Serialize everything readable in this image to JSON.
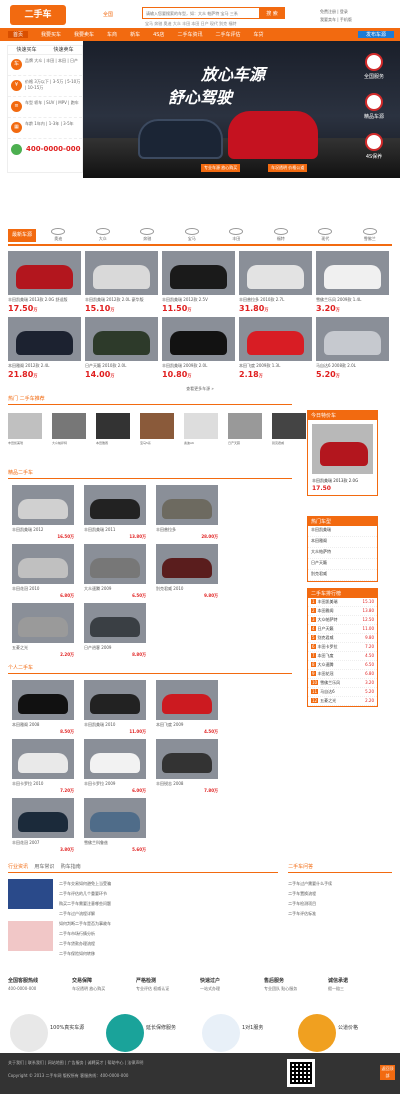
{
  "header": {
    "logo_text": "二手车",
    "city": "全国",
    "search_placeholder": "请输入您要搜索的车型，如：大众 帕萨特 宝马 三系",
    "search_button": "搜 索",
    "hot_keywords": "宝马 奔驰 奥迪 大众 丰田 本田 日产 现代 别克 福特",
    "top_links": [
      "免费注册",
      "登录",
      "我要卖车",
      "手机版"
    ]
  },
  "nav": {
    "items": [
      "首页",
      "我要买车",
      "我要卖车",
      "车商",
      "新车",
      "4S店",
      "二手车资讯",
      "二手车评估",
      "车贷"
    ],
    "right_button": "发布车源"
  },
  "left_panel": {
    "tabs": [
      "快速买车",
      "快速卖车"
    ],
    "rows": [
      {
        "icon": "car-icon",
        "text": "品牌 大众 | 丰田 | 本田 | 日产"
      },
      {
        "icon": "yuan-icon",
        "text": "价格 3万以下 | 3-5万 | 5-10万 | 10-15万"
      },
      {
        "icon": "list-icon",
        "text": "车型 轿车 | SUV | MPV | 跑车"
      },
      {
        "icon": "calendar-icon",
        "text": "车龄 1年内 | 1-3年 | 3-5年"
      }
    ],
    "phone": "400-0000-000"
  },
  "hero": {
    "slogan1": "放心车源",
    "slogan2": "舒心驾驶",
    "tag1": "专业车源 放心购买",
    "tag2": "车况透明 价格公道",
    "side": [
      "全国服务",
      "精品车源",
      "4S保养"
    ]
  },
  "brands": {
    "header": "最新车源",
    "items": [
      "奥迪",
      "大众",
      "奔驰",
      "宝马",
      "丰田",
      "福特",
      "现代",
      "雪佛兰"
    ]
  },
  "cars": [
    {
      "title": "丰田凯美瑞 2013款 2.0G 舒适版",
      "price": "17.50",
      "color": "#b3161e"
    },
    {
      "title": "丰田凯美瑞 2012款 2.0L 豪华版",
      "price": "15.10",
      "color": "#d9d9d9"
    },
    {
      "title": "丰田凯美瑞 2012款 2.5V",
      "price": "11.50",
      "color": "#1a1a1a"
    },
    {
      "title": "丰田普拉多 2010款 2.7L",
      "price": "31.80",
      "color": "#e3e3e3"
    },
    {
      "title": "雪佛兰乐风 2009款 1.4L",
      "price": "3.20",
      "color": "#f0f0f0"
    },
    {
      "title": "本田雅阁 2012款 2.4L",
      "price": "21.80",
      "color": "#1c2230"
    },
    {
      "title": "日产天籁 2010款 2.0L",
      "price": "14.00",
      "color": "#2d3a2a"
    },
    {
      "title": "丰田凯美瑞 2009款 2.0L",
      "price": "10.80",
      "color": "#121212"
    },
    {
      "title": "本田飞度 2009款 1.3L",
      "price": "2.18",
      "color": "#d81d24"
    },
    {
      "title": "马自达6 2008款 2.0L",
      "price": "5.20",
      "color": "#c6c9cf"
    }
  ],
  "price_unit": "万",
  "more_label": "查看更多车源 »",
  "recommend": {
    "header": "热门 二手车推荐",
    "thumbs": [
      "丰田凯美瑞",
      "大众帕萨特",
      "本田雅阁",
      "宝马5系",
      "奥迪A6",
      "日产天籁",
      "别克君威"
    ]
  },
  "featured": {
    "header": "今日特价车",
    "title": "丰田凯美瑞 2013款 2.0G",
    "price": "17.50"
  },
  "section_a": {
    "header": "精品二手车",
    "cars": [
      {
        "title": "丰田凯美瑞 2012",
        "price": "16.50万",
        "color": "#d0d0d0"
      },
      {
        "title": "丰田凯美瑞 2011",
        "price": "13.80万",
        "color": "#222"
      },
      {
        "title": "丰田普拉多",
        "price": "28.00万",
        "color": "#6d6a60"
      },
      {
        "title": "丰田花冠 2010",
        "price": "6.80万",
        "color": "#c0c0c0"
      },
      {
        "title": "大众速腾 2009",
        "price": "6.50万",
        "color": "#777"
      },
      {
        "title": "别克君威 2010",
        "price": "9.80万",
        "color": "#5a1d1d"
      },
      {
        "title": "五菱之光",
        "price": "2.20万",
        "color": "#9a9a9a"
      },
      {
        "title": "日产逍客 2009",
        "price": "8.80万",
        "color": "#3a3f44"
      }
    ]
  },
  "section_b": {
    "header": "个人二手车",
    "cars": [
      {
        "title": "本田雅阁 2008",
        "price": "8.50万",
        "color": "#111"
      },
      {
        "title": "丰田凯美瑞 2010",
        "price": "11.00万",
        "color": "#222"
      },
      {
        "title": "本田飞度 2009",
        "price": "4.50万",
        "color": "#cc1a20"
      },
      {
        "title": "丰田卡罗拉 2010",
        "price": "7.20万",
        "color": "#e9e9e9"
      },
      {
        "title": "丰田卡罗拉 2009",
        "price": "6.00万",
        "color": "#f2f2f2"
      },
      {
        "title": "丰田锐志 2008",
        "price": "7.80万",
        "color": "#333"
      },
      {
        "title": "丰田花冠 2007",
        "price": "3.80万",
        "color": "#1b2a3a"
      },
      {
        "title": "雪佛兰科鲁兹",
        "price": "5.60万",
        "color": "#4f6c89"
      }
    ]
  },
  "side_list": {
    "header1": "热门车型",
    "items1": [
      "丰田凯美瑞",
      "本田雅阁",
      "大众帕萨特",
      "日产天籁",
      "别克君威"
    ],
    "header2": "二手车排行榜",
    "ranks": [
      {
        "n": "1",
        "t": "丰田凯美瑞",
        "p": "15.10"
      },
      {
        "n": "2",
        "t": "本田雅阁",
        "p": "13.80"
      },
      {
        "n": "3",
        "t": "大众帕萨特",
        "p": "12.50"
      },
      {
        "n": "4",
        "t": "日产天籁",
        "p": "11.00"
      },
      {
        "n": "5",
        "t": "别克君威",
        "p": "9.80"
      },
      {
        "n": "6",
        "t": "丰田卡罗拉",
        "p": "7.20"
      },
      {
        "n": "7",
        "t": "本田飞度",
        "p": "4.50"
      },
      {
        "n": "8",
        "t": "大众速腾",
        "p": "6.50"
      },
      {
        "n": "9",
        "t": "丰田花冠",
        "p": "6.80"
      },
      {
        "n": "10",
        "t": "雪佛兰乐风",
        "p": "3.20"
      },
      {
        "n": "11",
        "t": "马自达6",
        "p": "5.20"
      },
      {
        "n": "12",
        "t": "五菱之光",
        "p": "2.20"
      }
    ]
  },
  "news": {
    "tabs": [
      "行业资讯",
      "用车常识",
      "购车指南"
    ],
    "items": [
      "二手车交易如何避免上当受骗",
      "二手车评估的几个重要环节",
      "购买二手车需要注意哪些问题",
      "二手车过户流程详解",
      "如何判断二手车是否为事故车",
      "二手车市场行情分析",
      "二手车贷款办理流程",
      "二手车保险如何转移"
    ],
    "right_header": "二手车问答",
    "right_items": [
      "二手车过户需要什么手续",
      "二手车置换流程",
      "二手车检测项目",
      "二手车评估标准"
    ]
  },
  "service": [
    {
      "title": "全国客服热线",
      "text": "400-0000-000"
    },
    {
      "title": "交易保障",
      "text": "车况透明 放心购买"
    },
    {
      "title": "严格检测",
      "text": "专业评估 权威认证"
    },
    {
      "title": "快速过户",
      "text": "一站式办理"
    },
    {
      "title": "售后服务",
      "text": "专业团队 贴心服务"
    },
    {
      "title": "诚信承诺",
      "text": "假一赔三"
    }
  ],
  "features": [
    "100%真实车源",
    "延长保修服务",
    "1对1服务",
    "公道价格"
  ],
  "links_header": "友情链接",
  "footer": {
    "links": "关于我们 | 联系我们 | 网站地图 | 广告服务 | 诚聘英才 | 帮助中心 | 法律声明",
    "copy": "Copyright © 2013 二手车网 版权所有 客服热线：400-0000-000",
    "to_top": "返回顶部"
  }
}
